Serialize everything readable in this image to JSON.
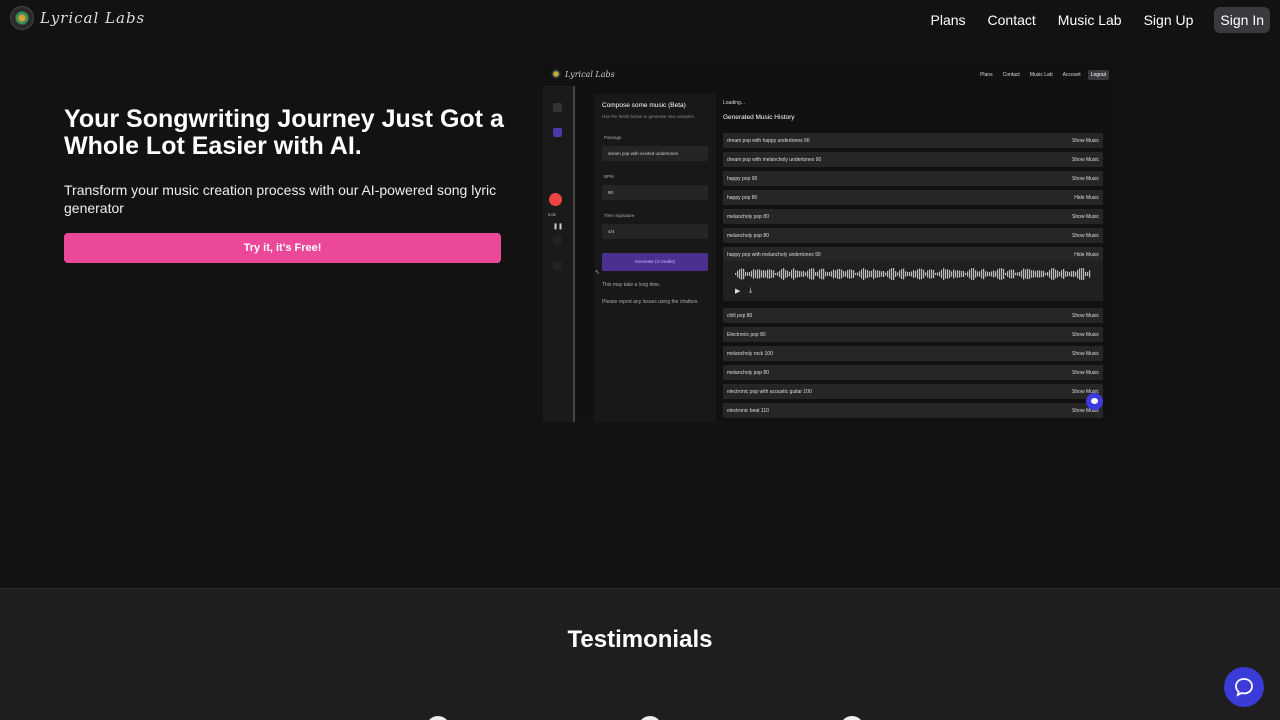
{
  "nav": {
    "logo_text": "Lyrical Labs",
    "links": [
      "Plans",
      "Contact",
      "Music Lab",
      "Sign Up"
    ],
    "signin_label": "Sign In"
  },
  "hero": {
    "title": "Your Songwriting Journey Just Got a Whole Lot Easier with AI.",
    "subtitle": "Transform your music creation process with our AI-powered song lyric generator",
    "cta_label": "Try it, it's Free!",
    "cta_color": "#ec4899"
  },
  "preview": {
    "logo_text": "Lyrical Labs",
    "nav_links": [
      "Plans",
      "Contact",
      "Music Lab",
      "Account"
    ],
    "logout_label": "Logout",
    "recording_time": "0:06",
    "form": {
      "title": "Compose some music (Beta)",
      "description": "Use the fields below to generate new samples.",
      "passage_label": "Passage",
      "passage_value": "dream pop with excited undertones",
      "bpm_label": "BPM",
      "bpm_value": "90",
      "time_signature_label": "Time Signature",
      "time_signature_value": "4/4",
      "generate_label": "Generate (3 credits)",
      "note_1": "This may take a long time.",
      "note_2": "Please report any issues using the chatbox."
    },
    "history": {
      "loading": "Loading...",
      "title": "Generated Music History",
      "rows": [
        {
          "name": "dream pop with happy undertones 90",
          "action": "Show Music"
        },
        {
          "name": "dream pop with melancholy undertones 90",
          "action": "Show Music"
        },
        {
          "name": "happy pop 90",
          "action": "Show Music"
        },
        {
          "name": "happy pop 80",
          "action": "Hide Music"
        },
        {
          "name": "melancholy pop 80",
          "action": "Show Music"
        },
        {
          "name": "melancholy pop 80",
          "action": "Show Music"
        },
        {
          "name": "happy pop with melancholy undertones 90",
          "action": "Hide Music"
        },
        {
          "name": "chill pop 80",
          "action": "Show Music"
        },
        {
          "name": "Electronic pop 80",
          "action": "Show Music"
        },
        {
          "name": "melancholy rock 100",
          "action": "Show Music"
        },
        {
          "name": "melancholy pop 80",
          "action": "Show Music"
        },
        {
          "name": "electronic pop with acoustic guitar 100",
          "action": "Show Music"
        },
        {
          "name": "electronic beat 110",
          "action": "Show Music"
        }
      ]
    }
  },
  "testimonials": {
    "title": "Testimonials"
  },
  "chat": {
    "icon": "chat-icon",
    "color": "#3b3bd8"
  }
}
